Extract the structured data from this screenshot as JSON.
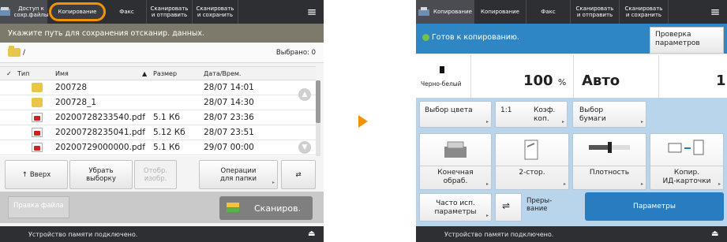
{
  "left": {
    "tabs": [
      {
        "label": "Доступ к\nсохр.файлы",
        "selected": true
      },
      {
        "label": "Копирование",
        "highlighted": true
      },
      {
        "label": "Факс"
      },
      {
        "label": "Сканировать\nи отправить"
      },
      {
        "label": "Сканировать\nи сохранить"
      }
    ],
    "menu_icon": "≡",
    "instruction": "Укажите путь для сохранения отсканир. данных.",
    "path": "/",
    "selected_count": "Выбрано: 0",
    "columns": {
      "check": "✓",
      "type": "Тип",
      "name": "Имя",
      "sort": "▲",
      "size": "Размер",
      "date": "Дата/Врем."
    },
    "files": [
      {
        "kind": "folder",
        "name": "200728",
        "size": "",
        "date": "28/07  14:01"
      },
      {
        "kind": "folder",
        "name": "200728_1",
        "size": "",
        "date": "28/07  14:30"
      },
      {
        "kind": "pdf",
        "name": "20200728233540.pdf",
        "size": "5.1 Кб",
        "date": "28/07  23:36"
      },
      {
        "kind": "pdf",
        "name": "20200728235041.pdf",
        "size": "5.12 Кб",
        "date": "28/07  23:51"
      },
      {
        "kind": "pdf",
        "name": "20200729000000.pdf",
        "size": "5.1 Кб",
        "date": "29/07  00:00"
      }
    ],
    "buttons": {
      "up": "Вверх",
      "clear": "Убрать\nвыборку",
      "display": "Отобр.\nизобр.",
      "folder_ops": "Операции\nдля папки",
      "refresh": "⇄"
    },
    "print_file": "Правка файла",
    "scan": "Сканиров.",
    "status": "Устройство памяти подключено.",
    "eject": "⏏"
  },
  "right": {
    "tabs": [
      {
        "label": "Копирование",
        "selected": true
      },
      {
        "label": "Копирование"
      },
      {
        "label": "Факс"
      },
      {
        "label": "Сканировать\nи отправить"
      },
      {
        "label": "Сканировать\nи сохранить"
      }
    ],
    "menu_icon": "≡",
    "ready": "Готов к копированию.",
    "check_settings": "Проверка\nпараметров",
    "mode": "Черно-белый",
    "zoom_value": "100",
    "zoom_unit": "%",
    "paper": "Авто",
    "copies": "1",
    "row1": {
      "color": "Выбор цвета",
      "ratio_label": "1:1",
      "ratio": "Коэф.\nкоп.",
      "paper_select": "Выбор\nбумаги"
    },
    "row2": {
      "finishing": "Конечная\nобраб.",
      "duplex": "2-стор.",
      "density": "Плотность",
      "id_copy": "Копир.\nИД-карточки"
    },
    "row3": {
      "favorites": "Часто исп.\nпараметры",
      "interrupt": "Преры-\nвание",
      "options": "Параметры"
    },
    "status": "Устройство памяти подключено.",
    "eject": "⏏"
  },
  "colors": {
    "accent_orange": "#f39200",
    "status_blue": "#2f86c5",
    "ready_green": "#72c14a",
    "dark_bar": "#2e2f33"
  }
}
